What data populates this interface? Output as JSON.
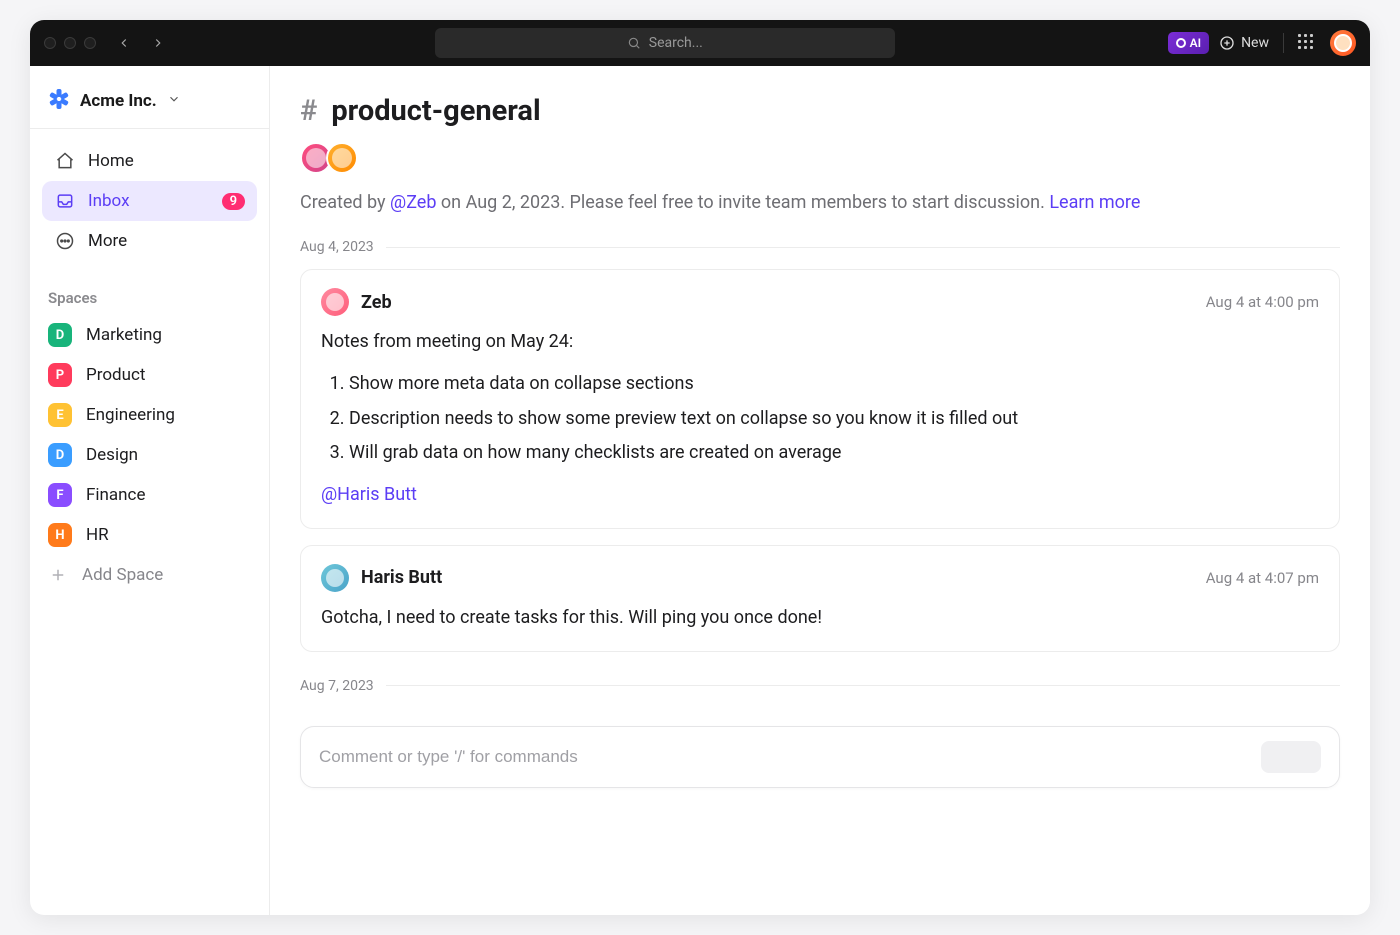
{
  "titlebar": {
    "search_placeholder": "Search...",
    "ai_label": "AI",
    "new_label": "New"
  },
  "workspace": {
    "name": "Acme Inc."
  },
  "nav": {
    "home": "Home",
    "inbox": "Inbox",
    "inbox_badge": "9",
    "more": "More"
  },
  "spaces_section_label": "Spaces",
  "spaces": [
    {
      "letter": "D",
      "label": "Marketing",
      "color": "#18b47b"
    },
    {
      "letter": "P",
      "label": "Product",
      "color": "#ff3b5c"
    },
    {
      "letter": "E",
      "label": "Engineering",
      "color": "#ffc233"
    },
    {
      "letter": "D",
      "label": "Design",
      "color": "#3a9dff"
    },
    {
      "letter": "F",
      "label": "Finance",
      "color": "#8a4dff"
    },
    {
      "letter": "H",
      "label": "HR",
      "color": "#ff7a1a"
    }
  ],
  "add_space_label": "Add Space",
  "channel": {
    "name": "product-general",
    "created_prefix": "Created by ",
    "creator": "@Zeb",
    "created_suffix": " on Aug 2, 2023. Please feel free to invite team members to start discussion. ",
    "learn_more": "Learn more"
  },
  "thread": [
    {
      "date": "Aug 4, 2023"
    }
  ],
  "messages": [
    {
      "author": "Zeb",
      "time": "Aug 4 at 4:00 pm",
      "intro": "Notes from meeting on May 24:",
      "list": [
        "Show more meta data on collapse sections",
        "Description needs to show some preview text on collapse so you know it is filled out",
        "Will grab data on how many checklists are created on average"
      ],
      "mention": "@Haris Butt"
    },
    {
      "author": "Haris Butt",
      "time": "Aug 4 at 4:07 pm",
      "body": "Gotcha, I need to create tasks for this. Will ping you once done!"
    }
  ],
  "thread2_date": "Aug 7, 2023",
  "composer": {
    "placeholder": "Comment or type '/' for commands"
  }
}
